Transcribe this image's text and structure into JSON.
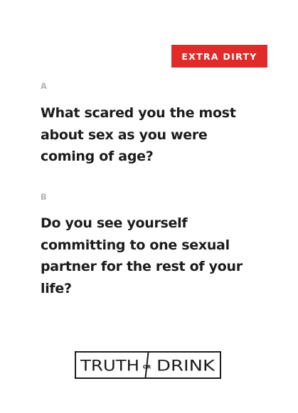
{
  "badge": {
    "label": "EXTRA DIRTY",
    "color": "#e12b2b"
  },
  "questions": [
    {
      "letter": "A",
      "text": "What scared you the most about sex as you were coming of age?"
    },
    {
      "letter": "B",
      "text": "Do you see yourself committing to one sexual partner for the rest of your life?"
    }
  ],
  "logo": {
    "left_word": "TRUTH",
    "middle_word": "OR",
    "right_word": "DRINK",
    "color": "#1c1c1c"
  }
}
